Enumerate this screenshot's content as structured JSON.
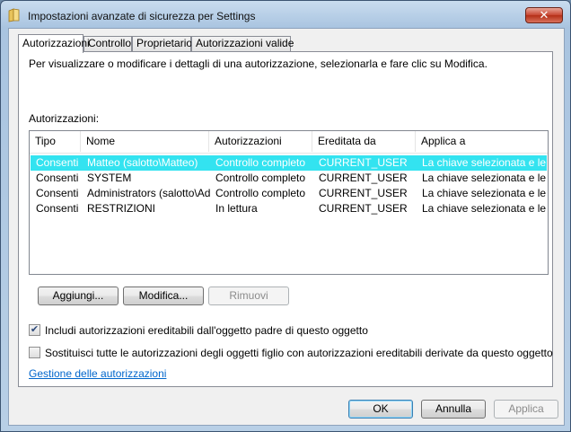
{
  "window": {
    "title": "Impostazioni avanzate di sicurezza per Settings",
    "close_symbol": "✕",
    "title_icon": "folder-icon"
  },
  "tabs": [
    {
      "label": "Autorizzazioni",
      "active": true
    },
    {
      "label": "Controllo",
      "active": false
    },
    {
      "label": "Proprietario",
      "active": false
    },
    {
      "label": "Autorizzazioni valide",
      "active": false
    }
  ],
  "panel": {
    "description": "Per visualizzare o modificare i dettagli di una autorizzazione, selezionarla e fare clic su Modifica.",
    "list_label": "Autorizzazioni:",
    "columns": [
      "Tipo",
      "Nome",
      "Autorizzazioni",
      "Ereditata da",
      "Applica a"
    ],
    "rows": [
      {
        "tipo": "Consenti",
        "nome": "Matteo (salotto\\Matteo)",
        "autorizzazioni": "Controllo completo",
        "ereditata": "CURRENT_USER",
        "applica": "La chiave selezionata e le...",
        "selected": true
      },
      {
        "tipo": "Consenti",
        "nome": "SYSTEM",
        "autorizzazioni": "Controllo completo",
        "ereditata": "CURRENT_USER",
        "applica": "La chiave selezionata e le...",
        "selected": false
      },
      {
        "tipo": "Consenti",
        "nome": "Administrators (salotto\\Ad...",
        "autorizzazioni": "Controllo completo",
        "ereditata": "CURRENT_USER",
        "applica": "La chiave selezionata e le...",
        "selected": false
      },
      {
        "tipo": "Consenti",
        "nome": "RESTRIZIONI",
        "autorizzazioni": "In lettura",
        "ereditata": "CURRENT_USER",
        "applica": "La chiave selezionata e le...",
        "selected": false
      }
    ],
    "buttons": {
      "add": "Aggiungi...",
      "edit": "Modifica...",
      "remove": "Rimuovi"
    },
    "checkboxes": [
      {
        "label": "Includi autorizzazioni ereditabili dall'oggetto padre di questo oggetto",
        "checked": true
      },
      {
        "label": "Sostituisci tutte le autorizzazioni degli oggetti figlio con autorizzazioni ereditabili derivate da questo oggetto",
        "checked": false
      }
    ],
    "check_mark": "✔",
    "link": "Gestione delle autorizzazioni"
  },
  "footer": {
    "ok": "OK",
    "cancel": "Annulla",
    "apply": "Applica"
  },
  "colors": {
    "selection": "#33e3f0",
    "link": "#0066cc"
  }
}
